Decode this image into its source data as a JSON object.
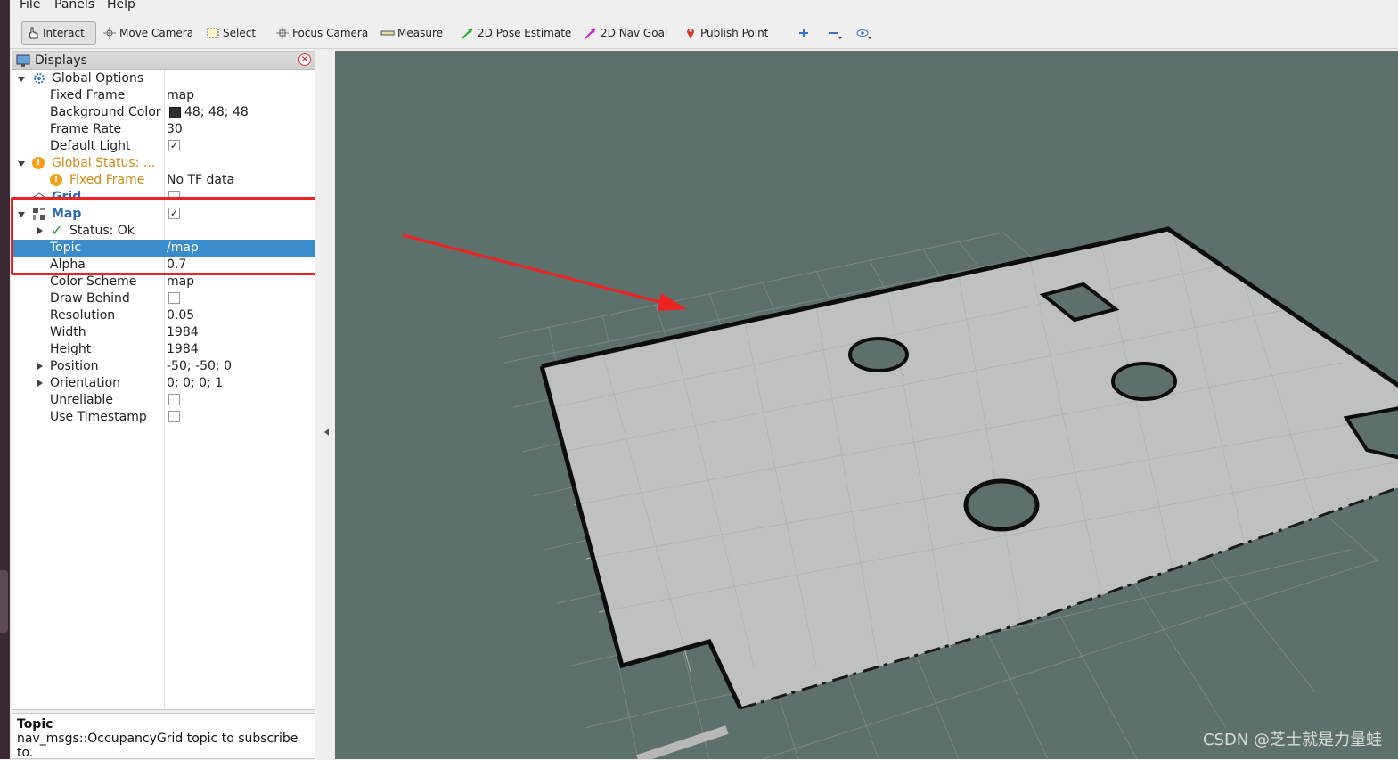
{
  "menu": [
    "File",
    "Panels",
    "Help"
  ],
  "toolbar": {
    "interact": "Interact",
    "move_camera": "Move Camera",
    "select": "Select",
    "focus_camera": "Focus Camera",
    "measure": "Measure",
    "pose_estimate": "2D Pose Estimate",
    "nav_goal": "2D Nav Goal",
    "publish_point": "Publish Point"
  },
  "displays_panel": {
    "title": "Displays",
    "rows": [
      {
        "name": "Global Options",
        "value": ""
      },
      {
        "name": "Fixed Frame",
        "value": "map"
      },
      {
        "name": "Background Color",
        "value": "48; 48; 48"
      },
      {
        "name": "Frame Rate",
        "value": "30"
      },
      {
        "name": "Default Light",
        "value": ""
      },
      {
        "name": "Global Status: ...",
        "value": ""
      },
      {
        "name": "Fixed Frame",
        "value": "No TF data"
      },
      {
        "name": "Grid",
        "value": ""
      },
      {
        "name": "Map",
        "value": ""
      },
      {
        "name": "Status: Ok",
        "value": ""
      },
      {
        "name": "Topic",
        "value": "/map"
      },
      {
        "name": "Alpha",
        "value": "0.7"
      },
      {
        "name": "Color Scheme",
        "value": "map"
      },
      {
        "name": "Draw Behind",
        "value": ""
      },
      {
        "name": "Resolution",
        "value": "0.05"
      },
      {
        "name": "Width",
        "value": "1984"
      },
      {
        "name": "Height",
        "value": "1984"
      },
      {
        "name": "Position",
        "value": "-50; -50; 0"
      },
      {
        "name": "Orientation",
        "value": "0; 0; 0; 1"
      },
      {
        "name": "Unreliable",
        "value": ""
      },
      {
        "name": "Use Timestamp",
        "value": ""
      }
    ]
  },
  "description": {
    "title": "Topic",
    "text": "nav_msgs::OccupancyGrid topic to subscribe to."
  },
  "watermark": "CSDN @芝士就是力量蛙",
  "colors": {
    "viewport_bg": "#5d706b",
    "map_free": "#c8c8c8",
    "selection": "#3b8ccb",
    "annotation_red": "#ee2222"
  }
}
